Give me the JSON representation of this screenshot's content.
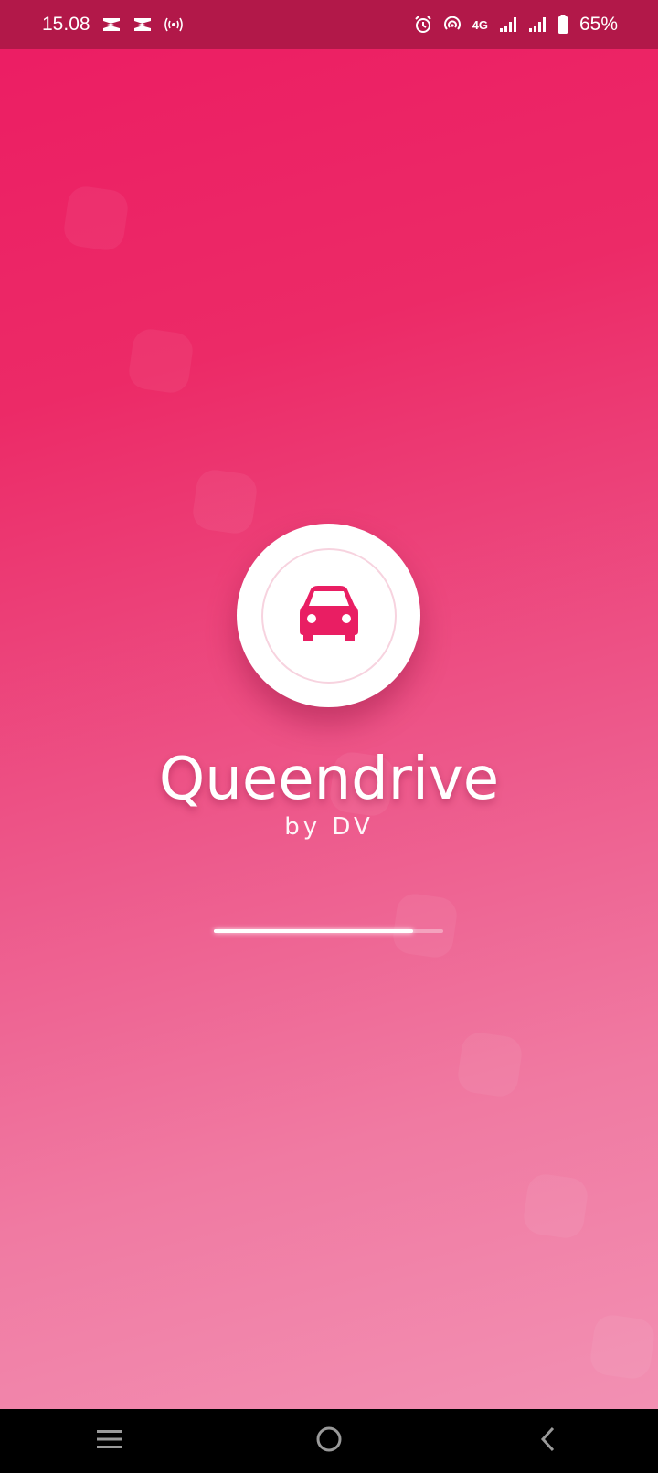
{
  "status_bar": {
    "time": "15.08",
    "network": "4G",
    "battery_percent": "65%",
    "left_icons": [
      "capcut-icon",
      "capcut-icon",
      "hotspot-icon"
    ],
    "right_icons": [
      "alarm-icon",
      "hotspot-icon",
      "network-4g-label",
      "signal-icon",
      "signal-icon",
      "battery-icon"
    ]
  },
  "splash": {
    "title": "Queendrive",
    "subtitle": "by DV",
    "logo_icon": "car-icon",
    "loading_progress": 0.87
  },
  "nav_bar": {
    "buttons": [
      "recent-apps-icon",
      "home-icon",
      "back-icon"
    ]
  },
  "colors": {
    "primary": "#ec1c63",
    "status_bar": "#b21849",
    "logo_icon": "#e91e63",
    "gradient_end": "#f394b6"
  }
}
